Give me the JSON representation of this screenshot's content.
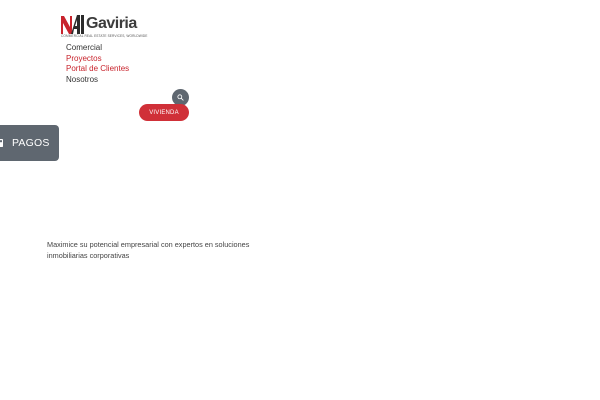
{
  "header": {
    "logo": {
      "brand": "NAI",
      "name": "Gaviria",
      "tagline": "COMMERCIAL REAL ESTATE SERVICES, WORLDWIDE"
    },
    "nav": {
      "items": [
        {
          "label": "Comercial",
          "active": false
        },
        {
          "label": "Proyectos",
          "active": true
        },
        {
          "label": "Portal de Clientes",
          "active": true
        },
        {
          "label": "Nosotros",
          "active": false
        }
      ]
    },
    "search": {
      "icon": "search-icon"
    },
    "cta": {
      "label": "VIVIENDA"
    }
  },
  "side_tab": {
    "label": "PAGOS",
    "icon": "payment-card-icon"
  },
  "hero": {
    "text": "Maximice su potencial empresarial con expertos en soluciones inmobiliarias corporativas"
  },
  "colors": {
    "accent_red": "#d03038",
    "nav_active": "#c8232c",
    "slate": "#5f6770",
    "text": "#333333"
  }
}
